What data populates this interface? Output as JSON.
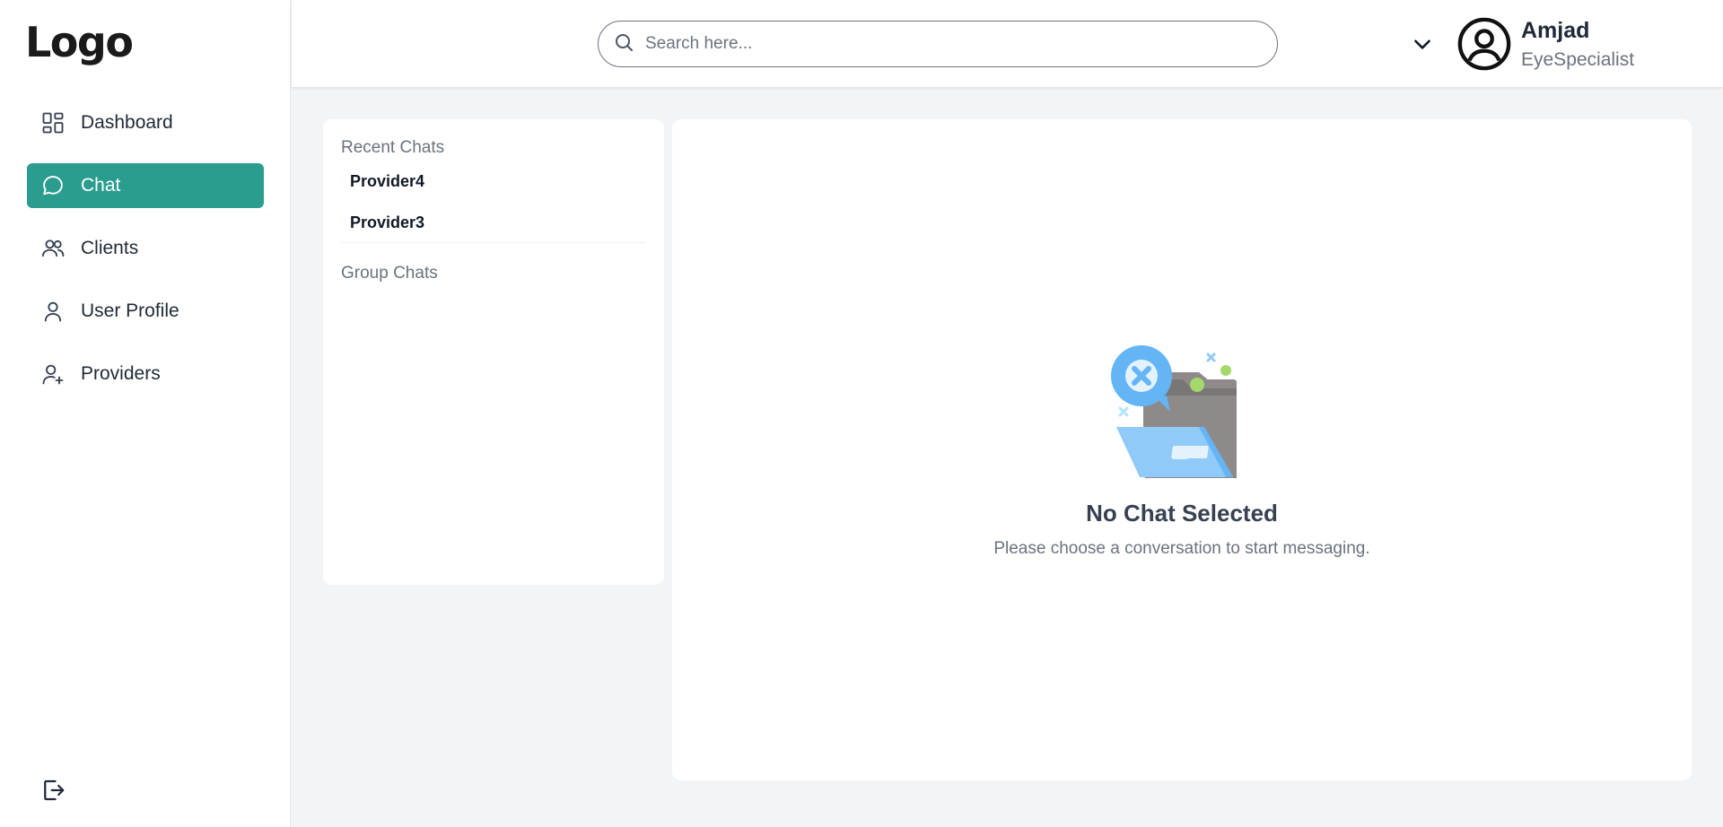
{
  "brand": {
    "logo_text": "Logo"
  },
  "sidebar": {
    "items": [
      {
        "label": "Dashboard",
        "icon": "dashboard-icon"
      },
      {
        "label": "Chat",
        "icon": "chat-bubble-icon",
        "active": true
      },
      {
        "label": "Clients",
        "icon": "users-icon"
      },
      {
        "label": "User Profile",
        "icon": "user-icon"
      },
      {
        "label": "Providers",
        "icon": "user-plus-icon"
      }
    ],
    "logout_icon": "logout-icon"
  },
  "header": {
    "search": {
      "placeholder": "Search here..."
    },
    "user": {
      "name": "Amjad",
      "role": "EyeSpecialist"
    }
  },
  "chat_list": {
    "recent_title": "Recent Chats",
    "recent": [
      "Provider4",
      "Provider3"
    ],
    "group_title": "Group Chats"
  },
  "chat_area": {
    "empty_title": "No Chat Selected",
    "empty_subtitle": "Please choose a conversation to start messaging."
  },
  "colors": {
    "accent": "#2a9d8f",
    "background": "#f3f4f6",
    "illustration_blue": "#64b5f6",
    "illustration_gray": "#8f8a8a",
    "illustration_green": "#a5d86a"
  }
}
